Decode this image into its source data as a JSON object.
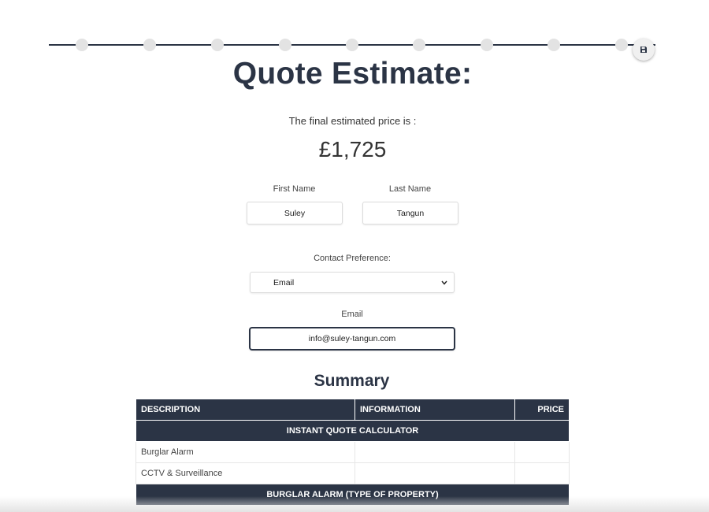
{
  "progress": {
    "steps": 9
  },
  "save": {
    "icon": "save-icon"
  },
  "heading": {
    "title": "Quote Estimate:"
  },
  "estimate": {
    "subtitle": "The final estimated price is :",
    "price": "£1,725"
  },
  "form": {
    "first_name": {
      "label": "First Name",
      "value": "Suley"
    },
    "last_name": {
      "label": "Last Name",
      "value": "Tangun"
    },
    "contact": {
      "label": "Contact Preference:",
      "value": "Email"
    },
    "email": {
      "label": "Email",
      "value": "info@suley-tangun.com"
    }
  },
  "summary": {
    "title": "Summary",
    "columns": [
      "DESCRIPTION",
      "INFORMATION",
      "PRICE"
    ],
    "sections": [
      {
        "title": "INSTANT QUOTE CALCULATOR",
        "rows": [
          {
            "description": "Burglar Alarm",
            "information": "",
            "price": ""
          },
          {
            "description": "CCTV & Surveillance",
            "information": "",
            "price": ""
          }
        ]
      },
      {
        "title": "BURGLAR ALARM (TYPE OF PROPERTY)",
        "rows": []
      }
    ]
  },
  "colors": {
    "navy": "#2b3445",
    "dot": "#e3e3e3"
  }
}
